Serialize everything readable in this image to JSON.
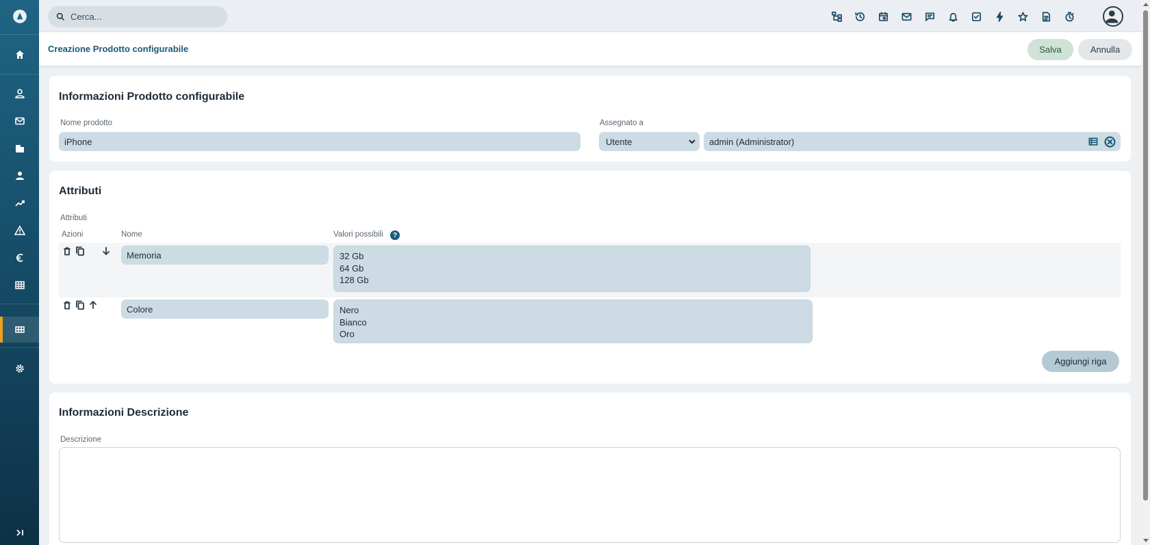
{
  "search": {
    "placeholder": "Cerca..."
  },
  "header": {
    "title": "Creazione Prodotto configurabile",
    "save_label": "Salva",
    "cancel_label": "Annulla"
  },
  "info_panel": {
    "title": "Informazioni Prodotto configurabile",
    "product_name_label": "Nome prodotto",
    "product_name_value": "iPhone",
    "assigned_label": "Assegnato a",
    "assigned_type": "Utente",
    "assigned_value": "admin (Administrator)"
  },
  "attributes_panel": {
    "title": "Attributi",
    "section_label": "Attributi",
    "col_actions": "Azioni",
    "col_name": "Nome",
    "col_values": "Valori possibili",
    "help_symbol": "?",
    "rows": [
      {
        "name": "Memoria",
        "values": "32 Gb\n64 Gb\n128 Gb"
      },
      {
        "name": "Colore",
        "values": "Nero\nBianco\nOro"
      }
    ],
    "add_row_label": "Aggiungi riga"
  },
  "description_panel": {
    "title": "Informazioni Descrizione",
    "label": "Descrizione"
  },
  "sidebar": {
    "icons": [
      "home-icon",
      "contact-icon",
      "mail-icon",
      "building-icon",
      "person-icon",
      "chart-line-icon",
      "warning-icon",
      "euro-icon",
      "table-icon",
      "grid-icon",
      "gear-icon",
      "expand-icon"
    ]
  },
  "topbar": {
    "icons": [
      "hierarchy-icon",
      "history-icon",
      "calendar-icon",
      "mail-icon",
      "chat-icon",
      "bell-icon",
      "task-icon",
      "lightning-icon",
      "star-icon",
      "document-icon",
      "timer-icon"
    ]
  },
  "colors": {
    "accent": "#1a5a78",
    "sidebar_active": "#f0a020",
    "field_bg": "#cddce4"
  }
}
